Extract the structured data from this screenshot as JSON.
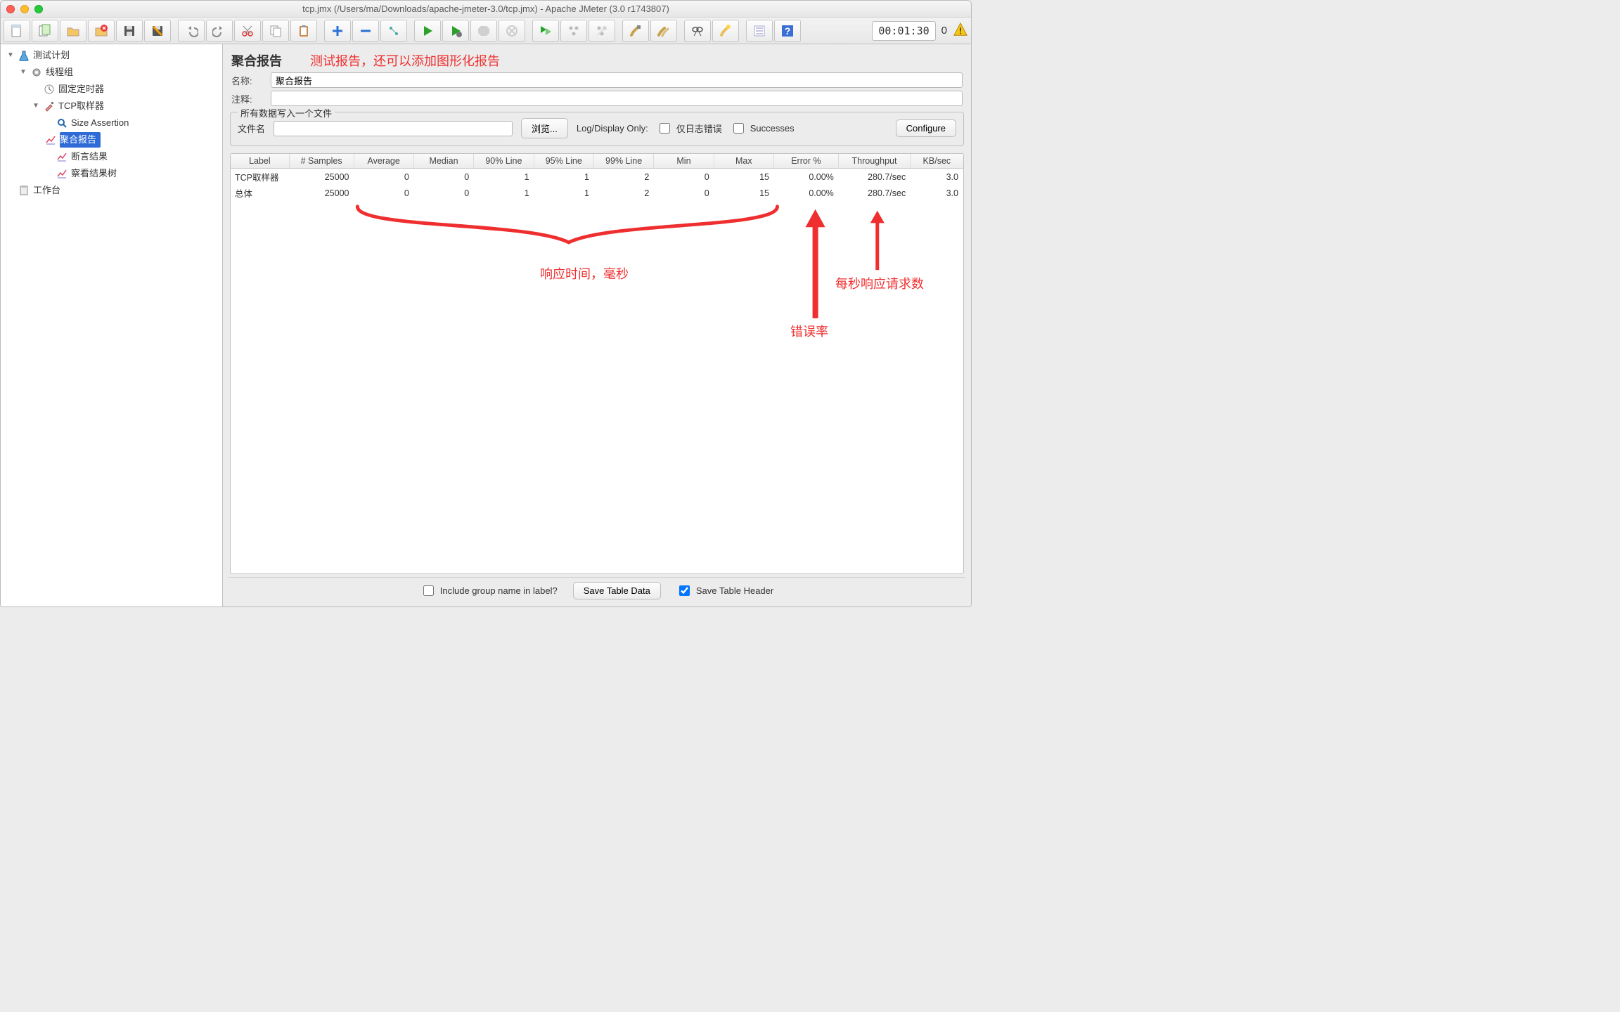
{
  "window": {
    "title": "tcp.jmx (/Users/ma/Downloads/apache-jmeter-3.0/tcp.jmx) - Apache JMeter (3.0 r1743807)"
  },
  "toolbar": {
    "timer": "00:01:30",
    "counter": "0"
  },
  "tree": {
    "root": "测试计划",
    "thread_group": "线程组",
    "timer": "固定定时器",
    "tcp_sampler": "TCP取样器",
    "size_assertion": "Size Assertion",
    "aggregate_report": "聚合报告",
    "assertion_results": "断言结果",
    "view_results_tree": "察看结果树",
    "workbench": "工作台"
  },
  "panel": {
    "title": "聚合报告",
    "annotation_title": "测试报告，还可以添加图形化报告",
    "name_label": "名称:",
    "name_value": "聚合报告",
    "comment_label": "注释:",
    "comment_value": "",
    "file_group_legend": "所有数据写入一个文件",
    "filename_label": "文件名",
    "filename_value": "",
    "browse_btn": "浏览...",
    "log_display_label": "Log/Display Only:",
    "errors_only": "仅日志错误",
    "successes": "Successes",
    "configure_btn": "Configure"
  },
  "table": {
    "headers": [
      "Label",
      "# Samples",
      "Average",
      "Median",
      "90% Line",
      "95% Line",
      "99% Line",
      "Min",
      "Max",
      "Error %",
      "Throughput",
      "KB/sec"
    ],
    "rows": [
      {
        "label": "TCP取样器",
        "samples": "25000",
        "avg": "0",
        "med": "0",
        "p90": "1",
        "p95": "1",
        "p99": "2",
        "min": "0",
        "max": "15",
        "err": "0.00%",
        "thr": "280.7/sec",
        "kb": "3.0"
      },
      {
        "label": "总体",
        "samples": "25000",
        "avg": "0",
        "med": "0",
        "p90": "1",
        "p95": "1",
        "p99": "2",
        "min": "0",
        "max": "15",
        "err": "0.00%",
        "thr": "280.7/sec",
        "kb": "3.0"
      }
    ]
  },
  "annotations": {
    "response_time": "响应时间，毫秒",
    "error_rate": "错误率",
    "throughput": "每秒响应请求数"
  },
  "footer": {
    "include_group": "Include group name in label?",
    "save_table_data": "Save Table Data",
    "save_table_header": "Save Table Header"
  }
}
